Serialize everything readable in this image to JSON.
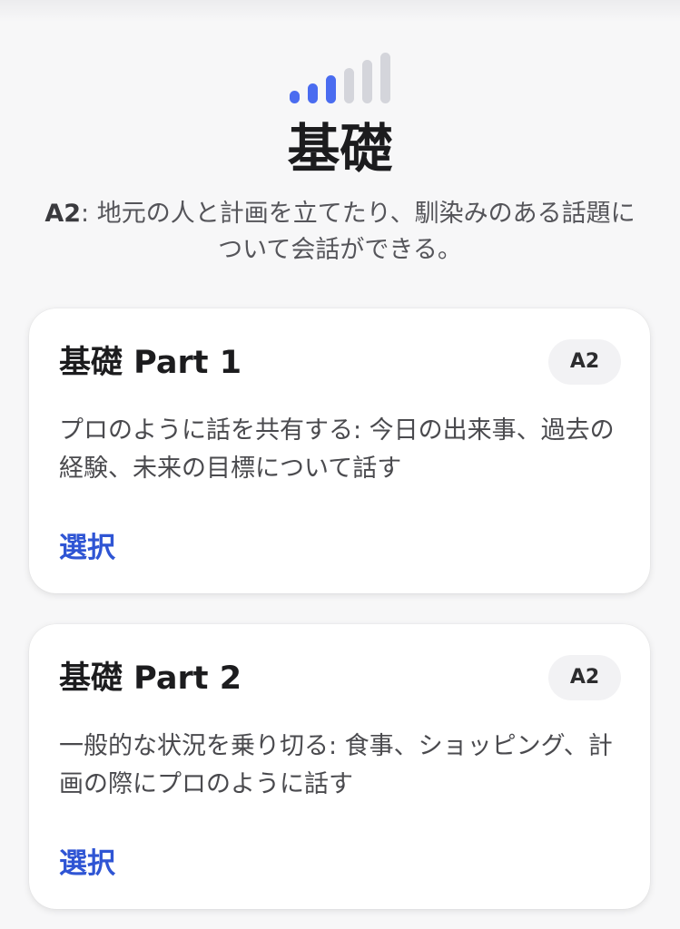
{
  "header": {
    "level_icon": "signal-bars-icon",
    "level_bars_filled": 3,
    "level_bars_total": 6,
    "title": "基礎",
    "subtitle_level": "A2",
    "subtitle_text": ": 地元の人と計画を立てたり、馴染みのある話題について会話ができる。"
  },
  "colors": {
    "accent": "#2f55d4",
    "bar_active": "#4a6cf0",
    "bar_inactive": "#d4d5db"
  },
  "cards": [
    {
      "title": "基礎 Part 1",
      "badge": "A2",
      "description": "プロのように話を共有する: 今日の出来事、過去の経験、未来の目標について話す",
      "select_label": "選択"
    },
    {
      "title": "基礎 Part 2",
      "badge": "A2",
      "description": "一般的な状況を乗り切る: 食事、ショッピング、計画の際にプロのように話す",
      "select_label": "選択"
    }
  ]
}
